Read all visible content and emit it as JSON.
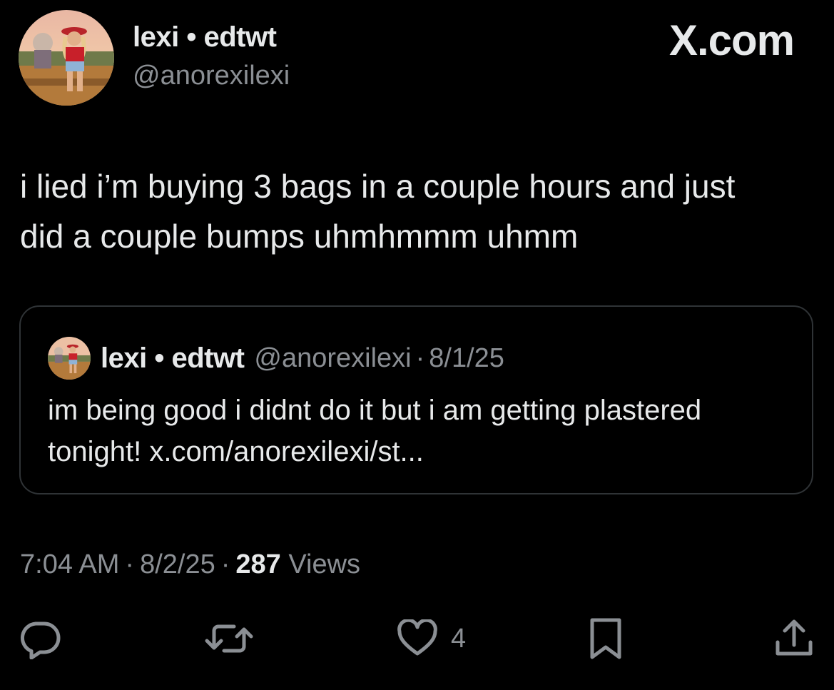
{
  "author": {
    "display_name": "lexi • edtwt",
    "handle": "@anorexilexi",
    "avatar_icon": "profile-photo"
  },
  "brand": "X.com",
  "tweet": {
    "line1": "i lied i’m buying 3 bags in a couple hours and just",
    "line2": "did a couple bumps uhmhmmm uhmm"
  },
  "quoted": {
    "display_name": "lexi • edtwt",
    "handle": "@anorexilexi",
    "separator": "·",
    "date": "8/1/25",
    "line1": "im being good i didnt do it but i am getting plastered",
    "line2": "tonight! x.com/anorexilexi/st..."
  },
  "meta": {
    "time": "7:04 AM",
    "separator": "·",
    "date": "8/2/25",
    "views_count": "287",
    "views_label": "Views"
  },
  "actions": {
    "reply_icon": "reply-icon",
    "repost_icon": "repost-icon",
    "like_icon": "heart-icon",
    "like_count": "4",
    "bookmark_icon": "bookmark-icon",
    "share_icon": "share-icon"
  },
  "colors": {
    "background": "#000000",
    "text_primary": "#e7e9ea",
    "text_secondary": "#8b8f94",
    "border": "#2f3336"
  }
}
